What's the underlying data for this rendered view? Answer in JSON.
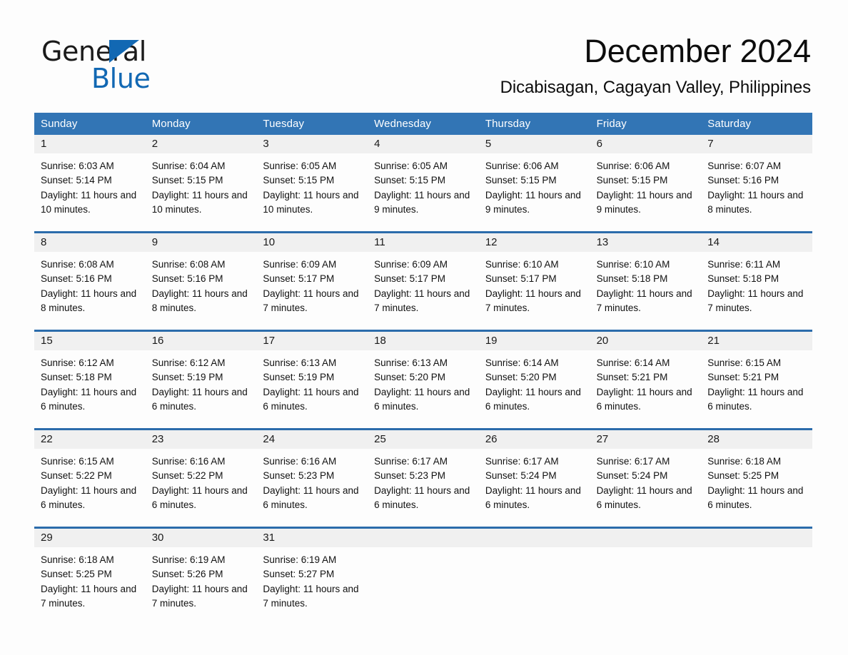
{
  "brand": {
    "line1": "General",
    "line2": "Blue",
    "triangle_color": "#1268b3",
    "text_color": "#1a1a1a"
  },
  "header": {
    "title": "December 2024",
    "location": "Dicabisagan, Cagayan Valley, Philippines"
  },
  "theme": {
    "header_blue": "#3275b5",
    "row_border_blue": "#2b6cab",
    "day_band_gray": "#f0f0f0",
    "page_background": "#fdfdfd",
    "text": "#111111"
  },
  "weekdays": [
    "Sunday",
    "Monday",
    "Tuesday",
    "Wednesday",
    "Thursday",
    "Friday",
    "Saturday"
  ],
  "labels": {
    "sunrise_prefix": "Sunrise:",
    "sunset_prefix": "Sunset:",
    "daylight_prefix": "Daylight:"
  },
  "weeks": [
    [
      {
        "day": "1",
        "sunrise": "Sunrise: 6:03 AM",
        "sunset": "Sunset: 5:14 PM",
        "daylight": "Daylight: 11 hours and 10 minutes."
      },
      {
        "day": "2",
        "sunrise": "Sunrise: 6:04 AM",
        "sunset": "Sunset: 5:15 PM",
        "daylight": "Daylight: 11 hours and 10 minutes."
      },
      {
        "day": "3",
        "sunrise": "Sunrise: 6:05 AM",
        "sunset": "Sunset: 5:15 PM",
        "daylight": "Daylight: 11 hours and 10 minutes."
      },
      {
        "day": "4",
        "sunrise": "Sunrise: 6:05 AM",
        "sunset": "Sunset: 5:15 PM",
        "daylight": "Daylight: 11 hours and 9 minutes."
      },
      {
        "day": "5",
        "sunrise": "Sunrise: 6:06 AM",
        "sunset": "Sunset: 5:15 PM",
        "daylight": "Daylight: 11 hours and 9 minutes."
      },
      {
        "day": "6",
        "sunrise": "Sunrise: 6:06 AM",
        "sunset": "Sunset: 5:15 PM",
        "daylight": "Daylight: 11 hours and 9 minutes."
      },
      {
        "day": "7",
        "sunrise": "Sunrise: 6:07 AM",
        "sunset": "Sunset: 5:16 PM",
        "daylight": "Daylight: 11 hours and 8 minutes."
      }
    ],
    [
      {
        "day": "8",
        "sunrise": "Sunrise: 6:08 AM",
        "sunset": "Sunset: 5:16 PM",
        "daylight": "Daylight: 11 hours and 8 minutes."
      },
      {
        "day": "9",
        "sunrise": "Sunrise: 6:08 AM",
        "sunset": "Sunset: 5:16 PM",
        "daylight": "Daylight: 11 hours and 8 minutes."
      },
      {
        "day": "10",
        "sunrise": "Sunrise: 6:09 AM",
        "sunset": "Sunset: 5:17 PM",
        "daylight": "Daylight: 11 hours and 7 minutes."
      },
      {
        "day": "11",
        "sunrise": "Sunrise: 6:09 AM",
        "sunset": "Sunset: 5:17 PM",
        "daylight": "Daylight: 11 hours and 7 minutes."
      },
      {
        "day": "12",
        "sunrise": "Sunrise: 6:10 AM",
        "sunset": "Sunset: 5:17 PM",
        "daylight": "Daylight: 11 hours and 7 minutes."
      },
      {
        "day": "13",
        "sunrise": "Sunrise: 6:10 AM",
        "sunset": "Sunset: 5:18 PM",
        "daylight": "Daylight: 11 hours and 7 minutes."
      },
      {
        "day": "14",
        "sunrise": "Sunrise: 6:11 AM",
        "sunset": "Sunset: 5:18 PM",
        "daylight": "Daylight: 11 hours and 7 minutes."
      }
    ],
    [
      {
        "day": "15",
        "sunrise": "Sunrise: 6:12 AM",
        "sunset": "Sunset: 5:18 PM",
        "daylight": "Daylight: 11 hours and 6 minutes."
      },
      {
        "day": "16",
        "sunrise": "Sunrise: 6:12 AM",
        "sunset": "Sunset: 5:19 PM",
        "daylight": "Daylight: 11 hours and 6 minutes."
      },
      {
        "day": "17",
        "sunrise": "Sunrise: 6:13 AM",
        "sunset": "Sunset: 5:19 PM",
        "daylight": "Daylight: 11 hours and 6 minutes."
      },
      {
        "day": "18",
        "sunrise": "Sunrise: 6:13 AM",
        "sunset": "Sunset: 5:20 PM",
        "daylight": "Daylight: 11 hours and 6 minutes."
      },
      {
        "day": "19",
        "sunrise": "Sunrise: 6:14 AM",
        "sunset": "Sunset: 5:20 PM",
        "daylight": "Daylight: 11 hours and 6 minutes."
      },
      {
        "day": "20",
        "sunrise": "Sunrise: 6:14 AM",
        "sunset": "Sunset: 5:21 PM",
        "daylight": "Daylight: 11 hours and 6 minutes."
      },
      {
        "day": "21",
        "sunrise": "Sunrise: 6:15 AM",
        "sunset": "Sunset: 5:21 PM",
        "daylight": "Daylight: 11 hours and 6 minutes."
      }
    ],
    [
      {
        "day": "22",
        "sunrise": "Sunrise: 6:15 AM",
        "sunset": "Sunset: 5:22 PM",
        "daylight": "Daylight: 11 hours and 6 minutes."
      },
      {
        "day": "23",
        "sunrise": "Sunrise: 6:16 AM",
        "sunset": "Sunset: 5:22 PM",
        "daylight": "Daylight: 11 hours and 6 minutes."
      },
      {
        "day": "24",
        "sunrise": "Sunrise: 6:16 AM",
        "sunset": "Sunset: 5:23 PM",
        "daylight": "Daylight: 11 hours and 6 minutes."
      },
      {
        "day": "25",
        "sunrise": "Sunrise: 6:17 AM",
        "sunset": "Sunset: 5:23 PM",
        "daylight": "Daylight: 11 hours and 6 minutes."
      },
      {
        "day": "26",
        "sunrise": "Sunrise: 6:17 AM",
        "sunset": "Sunset: 5:24 PM",
        "daylight": "Daylight: 11 hours and 6 minutes."
      },
      {
        "day": "27",
        "sunrise": "Sunrise: 6:17 AM",
        "sunset": "Sunset: 5:24 PM",
        "daylight": "Daylight: 11 hours and 6 minutes."
      },
      {
        "day": "28",
        "sunrise": "Sunrise: 6:18 AM",
        "sunset": "Sunset: 5:25 PM",
        "daylight": "Daylight: 11 hours and 6 minutes."
      }
    ],
    [
      {
        "day": "29",
        "sunrise": "Sunrise: 6:18 AM",
        "sunset": "Sunset: 5:25 PM",
        "daylight": "Daylight: 11 hours and 7 minutes."
      },
      {
        "day": "30",
        "sunrise": "Sunrise: 6:19 AM",
        "sunset": "Sunset: 5:26 PM",
        "daylight": "Daylight: 11 hours and 7 minutes."
      },
      {
        "day": "31",
        "sunrise": "Sunrise: 6:19 AM",
        "sunset": "Sunset: 5:27 PM",
        "daylight": "Daylight: 11 hours and 7 minutes."
      },
      {
        "day": "",
        "sunrise": "",
        "sunset": "",
        "daylight": ""
      },
      {
        "day": "",
        "sunrise": "",
        "sunset": "",
        "daylight": ""
      },
      {
        "day": "",
        "sunrise": "",
        "sunset": "",
        "daylight": ""
      },
      {
        "day": "",
        "sunrise": "",
        "sunset": "",
        "daylight": ""
      }
    ]
  ]
}
